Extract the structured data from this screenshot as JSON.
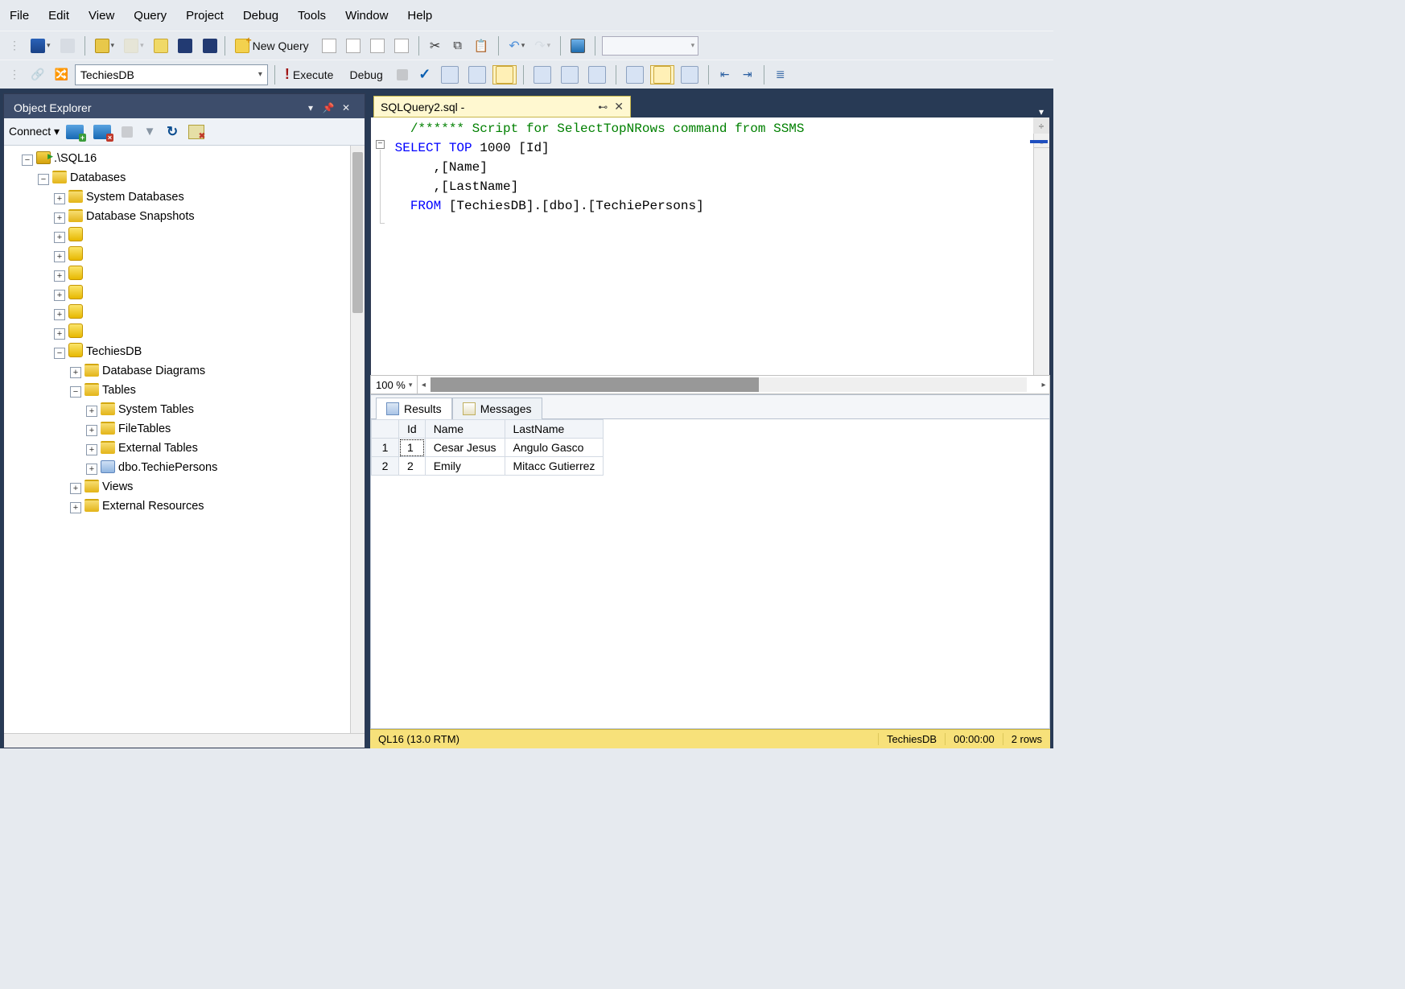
{
  "menu": {
    "file": "File",
    "edit": "Edit",
    "view": "View",
    "query": "Query",
    "project": "Project",
    "debug": "Debug",
    "tools": "Tools",
    "window": "Window",
    "help": "Help"
  },
  "toolbar": {
    "new_query": "New Query",
    "execute": "Execute",
    "debug": "Debug",
    "zoom": "100 %",
    "database": "TechiesDB"
  },
  "object_explorer": {
    "title": "Object Explorer",
    "connect": "Connect",
    "server": ".\\SQL16",
    "nodes": {
      "databases": "Databases",
      "system_databases": "System Databases",
      "database_snapshots": "Database Snapshots",
      "techiesdb": "TechiesDB",
      "database_diagrams": "Database Diagrams",
      "tables": "Tables",
      "system_tables": "System Tables",
      "filetables": "FileTables",
      "external_tables": "External Tables",
      "techie_persons": "dbo.TechiePersons",
      "views": "Views",
      "external_resources": "External Resources"
    }
  },
  "editor": {
    "tab_title": "SQLQuery2.sql -",
    "comment": "/****** Script for SelectTopNRows command from SSMS",
    "line1_a": "SELECT",
    "line1_b": "TOP",
    "line1_c": " 1000 [Id]",
    "line2": "      ,[Name]",
    "line3": "      ,[LastName]",
    "line4_a": "  FROM",
    "line4_b": " [TechiesDB].[dbo].[TechiePersons]"
  },
  "results": {
    "tab_results": "Results",
    "tab_messages": "Messages",
    "columns": [
      "Id",
      "Name",
      "LastName"
    ],
    "rows": [
      {
        "n": "1",
        "Id": "1",
        "Name": "Cesar Jesus",
        "LastName": "Angulo Gasco"
      },
      {
        "n": "2",
        "Id": "2",
        "Name": "Emily",
        "LastName": "Mitacc Gutierrez"
      }
    ]
  },
  "status": {
    "server": "QL16 (13.0 RTM)",
    "db": "TechiesDB",
    "time": "00:00:00",
    "rows": "2 rows"
  }
}
